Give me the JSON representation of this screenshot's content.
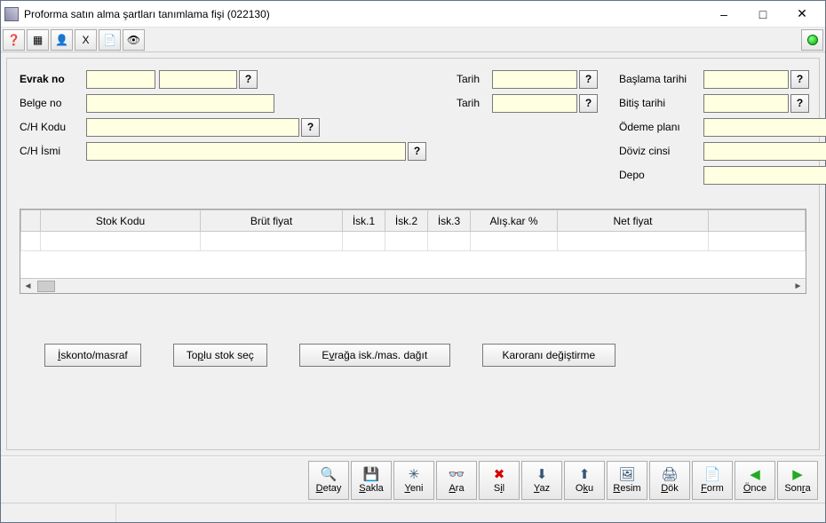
{
  "window": {
    "title": "Proforma satın alma şartları tanımlama fişi (022130)"
  },
  "toolbar_icons": [
    "help",
    "grid",
    "user",
    "xls",
    "note",
    "eye"
  ],
  "form": {
    "col1": {
      "evrak_no_label": "Evrak no",
      "evrak_no1": "",
      "evrak_no2": "",
      "belge_no_label": "Belge no",
      "belge_no": "",
      "ch_kodu_label": "C/H Kodu",
      "ch_kodu": "",
      "ch_ismi_label": "C/H İsmi",
      "ch_ismi": ""
    },
    "col2": {
      "tarih1_label": "Tarih",
      "tarih1": "",
      "tarih2_label": "Tarih",
      "tarih2": ""
    },
    "col3": {
      "baslama_label": "Başlama tarihi",
      "baslama": "",
      "bitis_label": "Bitiş tarihi",
      "bitis": "",
      "odeme_label": "Ödeme planı",
      "odeme": "",
      "doviz_label": "Döviz cinsi",
      "doviz": "",
      "depo_label": "Depo",
      "depo": ""
    },
    "q": "?"
  },
  "grid": {
    "headers": [
      "",
      "Stok Kodu",
      "Brüt fiyat",
      "İsk.1",
      "İsk.2",
      "İsk.3",
      "Alış.kar %",
      "Net fiyat",
      ""
    ]
  },
  "actions": {
    "iskonto": "İskonto/masraf",
    "toplu": "Toplu stok seç",
    "evraga": "Evrağa isk./mas. dağıt",
    "karorani": "Karoranı değiştirme"
  },
  "bottom": [
    {
      "key": "detay",
      "label": "Detay",
      "u": 0,
      "icon": "🔍"
    },
    {
      "key": "sakla",
      "label": "Sakla",
      "u": 0,
      "icon": "💾"
    },
    {
      "key": "yeni",
      "label": "Yeni",
      "u": 0,
      "icon": "✳"
    },
    {
      "key": "ara",
      "label": "Ara",
      "u": 0,
      "icon": "👓"
    },
    {
      "key": "sil",
      "label": "Sil",
      "u": 1,
      "icon": "✖"
    },
    {
      "key": "yaz",
      "label": "Yaz",
      "u": 0,
      "icon": "⬇"
    },
    {
      "key": "oku",
      "label": "Oku",
      "u": 1,
      "icon": "⬆"
    },
    {
      "key": "resim",
      "label": "Resim",
      "u": 0,
      "icon": "🖼"
    },
    {
      "key": "dok",
      "label": "Dök",
      "u": 0,
      "icon": "🖨"
    },
    {
      "key": "form",
      "label": "Form",
      "u": 0,
      "icon": "📄"
    },
    {
      "key": "once",
      "label": "Önce",
      "u": 0,
      "icon": "◀"
    },
    {
      "key": "sonra",
      "label": "Sonra",
      "u": 3,
      "icon": "▶"
    }
  ]
}
